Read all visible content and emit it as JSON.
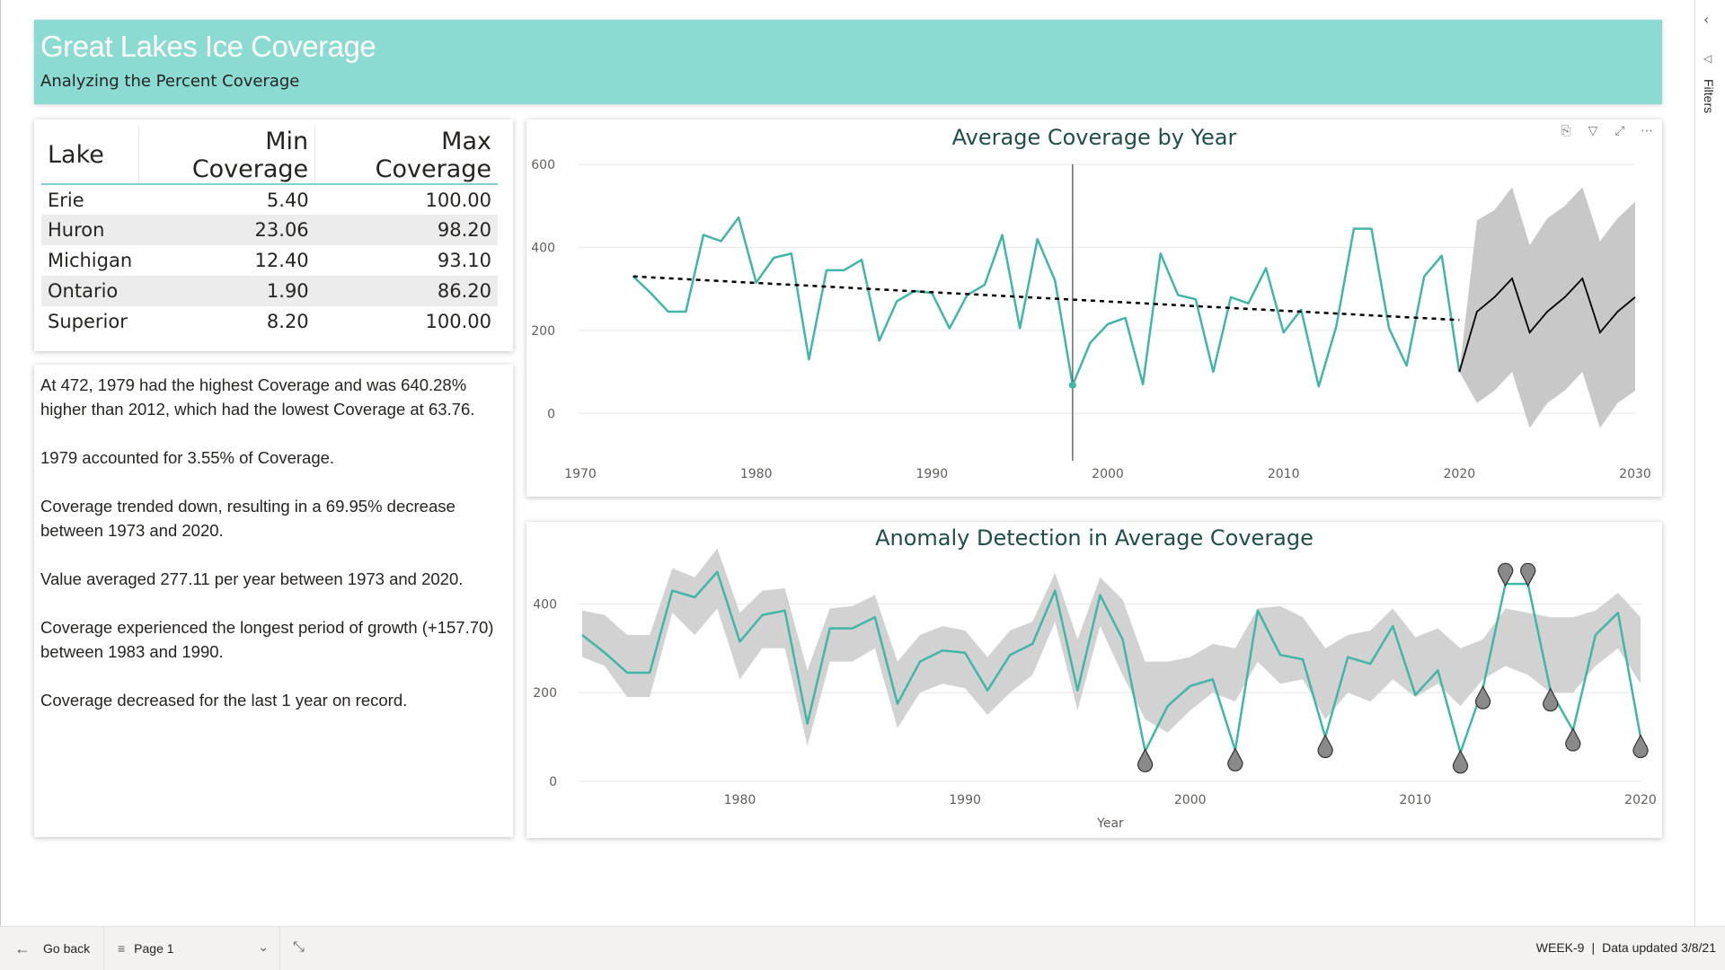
{
  "header": {
    "title": "Great Lakes Ice Coverage",
    "subtitle": "Analyzing the Percent Coverage",
    "banner_color": "#8cdbd3"
  },
  "table": {
    "columns": [
      "Lake",
      "Min Coverage",
      "Max Coverage"
    ],
    "rows": [
      {
        "lake": "Erie",
        "min": "5.40",
        "max": "100.00"
      },
      {
        "lake": "Huron",
        "min": "23.06",
        "max": "98.20"
      },
      {
        "lake": "Michigan",
        "min": "12.40",
        "max": "93.10"
      },
      {
        "lake": "Ontario",
        "min": "1.90",
        "max": "86.20"
      },
      {
        "lake": "Superior",
        "min": "8.20",
        "max": "100.00"
      }
    ]
  },
  "insights": [
    "At 472, 1979 had the highest Coverage and was 640.28% higher than 2012, which had the lowest Coverage at 63.76.",
    "1979 accounted for 3.55% of Coverage.",
    "Coverage trended down, resulting in a 69.95% decrease between 1973 and 2020.",
    "Value averaged 277.11 per year between 1973 and 2020.",
    "Coverage experienced the longest period of growth (+157.70) between 1983 and 1990.",
    "Coverage decreased for the last 1 year on record."
  ],
  "visual_header_icons": [
    "copy-icon",
    "filter-icon",
    "focus-mode-icon",
    "more-options-icon"
  ],
  "chart_data": [
    {
      "type": "line",
      "title": "Average Coverage by Year",
      "xlabel": "",
      "ylabel": "",
      "xlim": [
        1970,
        2030
      ],
      "ylim": [
        -60,
        600
      ],
      "x_ticks": [
        "1970",
        "1980",
        "1990",
        "2000",
        "2010",
        "2020",
        "2030"
      ],
      "y_ticks": [
        "0",
        "200",
        "400",
        "600"
      ],
      "series": [
        {
          "x": [
            1973,
            1974,
            1975,
            1976,
            1977,
            1978,
            1979,
            1980,
            1981,
            1982,
            1983,
            1984,
            1985,
            1986,
            1987,
            1988,
            1989,
            1990,
            1991,
            1992,
            1993,
            1994,
            1995,
            1996,
            1997,
            1998,
            1999,
            2000,
            2001,
            2002,
            2003,
            2004,
            2005,
            2006,
            2007,
            2008,
            2009,
            2010,
            2011,
            2012,
            2013,
            2014,
            2015,
            2016,
            2017,
            2018,
            2019,
            2020
          ],
          "values": [
            330,
            290,
            245,
            245,
            430,
            415,
            472,
            315,
            375,
            385,
            130,
            345,
            345,
            370,
            175,
            270,
            295,
            290,
            205,
            285,
            310,
            430,
            205,
            420,
            320,
            68,
            170,
            215,
            230,
            70,
            385,
            285,
            275,
            100,
            280,
            265,
            350,
            195,
            250,
            65,
            210,
            445,
            445,
            205,
            115,
            330,
            380,
            100
          ]
        }
      ],
      "trend_line": {
        "x": [
          1973,
          2020
        ],
        "y": [
          330,
          225
        ]
      },
      "forecast": {
        "x": [
          2020,
          2021,
          2022,
          2023,
          2024,
          2025,
          2026,
          2027,
          2028,
          2029,
          2030
        ],
        "values": [
          100,
          245,
          280,
          325,
          195,
          245,
          280,
          325,
          195,
          245,
          280
        ],
        "upper": [
          100,
          465,
          490,
          545,
          405,
          470,
          500,
          545,
          415,
          470,
          510
        ],
        "lower": [
          100,
          25,
          55,
          100,
          -35,
          25,
          55,
          100,
          -35,
          25,
          55
        ]
      },
      "reference_line_x": 1998,
      "grid": true,
      "colors": {
        "series": "#41b6a6",
        "forecast": "#000000",
        "band": "#c8c8c8"
      }
    },
    {
      "type": "line",
      "title": "Anomaly Detection in Average Coverage",
      "xlabel": "Year",
      "ylabel": "",
      "xlim": [
        1973,
        2020
      ],
      "ylim": [
        0,
        500
      ],
      "x_ticks": [
        "1980",
        "1990",
        "2000",
        "2010",
        "2020"
      ],
      "y_ticks": [
        "0",
        "200",
        "400"
      ],
      "series": [
        {
          "x": [
            1973,
            1974,
            1975,
            1976,
            1977,
            1978,
            1979,
            1980,
            1981,
            1982,
            1983,
            1984,
            1985,
            1986,
            1987,
            1988,
            1989,
            1990,
            1991,
            1992,
            1993,
            1994,
            1995,
            1996,
            1997,
            1998,
            1999,
            2000,
            2001,
            2002,
            2003,
            2004,
            2005,
            2006,
            2007,
            2008,
            2009,
            2010,
            2011,
            2012,
            2013,
            2014,
            2015,
            2016,
            2017,
            2018,
            2019,
            2020
          ],
          "values": [
            330,
            290,
            245,
            245,
            430,
            415,
            472,
            315,
            375,
            385,
            130,
            345,
            345,
            370,
            175,
            270,
            295,
            290,
            205,
            285,
            310,
            430,
            205,
            420,
            320,
            68,
            170,
            215,
            230,
            70,
            385,
            285,
            275,
            100,
            280,
            265,
            350,
            195,
            250,
            65,
            210,
            445,
            445,
            205,
            115,
            330,
            380,
            100
          ],
          "upper": [
            385,
            375,
            330,
            330,
            480,
            460,
            525,
            380,
            430,
            435,
            250,
            390,
            395,
            420,
            270,
            330,
            350,
            340,
            280,
            340,
            360,
            470,
            320,
            460,
            410,
            270,
            270,
            280,
            310,
            300,
            390,
            395,
            370,
            300,
            330,
            340,
            390,
            325,
            345,
            300,
            320,
            390,
            380,
            370,
            370,
            385,
            425,
            370
          ],
          "lower": [
            280,
            260,
            190,
            190,
            380,
            330,
            390,
            230,
            300,
            300,
            80,
            270,
            270,
            300,
            120,
            200,
            220,
            210,
            150,
            200,
            240,
            360,
            160,
            350,
            240,
            140,
            110,
            160,
            200,
            180,
            270,
            220,
            230,
            140,
            200,
            180,
            230,
            190,
            220,
            170,
            230,
            260,
            240,
            200,
            200,
            260,
            300,
            220
          ]
        }
      ],
      "anomalies_x": [
        1998,
        2002,
        2006,
        2012,
        2013,
        2014,
        2015,
        2016,
        2017,
        2020
      ],
      "grid": true,
      "colors": {
        "series": "#41b6a6",
        "band": "#d2d2d2",
        "marker": "#8a8a8a"
      }
    }
  ],
  "filters": {
    "label": "Filters"
  },
  "bottom_bar": {
    "go_back": "Go back",
    "page": "Page 1",
    "week": "WEEK-9",
    "separator": "|",
    "updated": "Data updated 3/8/21"
  }
}
